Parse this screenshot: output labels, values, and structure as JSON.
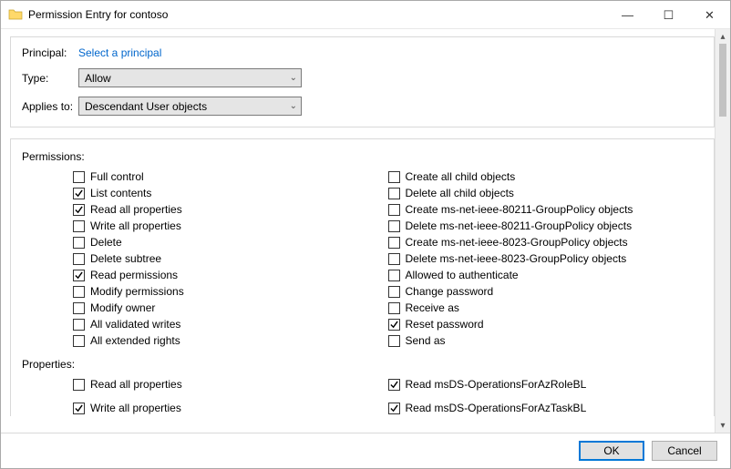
{
  "window": {
    "title": "Permission Entry for contoso",
    "minimize_glyph": "—",
    "maximize_glyph": "☐",
    "close_glyph": "✕"
  },
  "header": {
    "principal_label": "Principal:",
    "principal_link": "Select a principal",
    "type_label": "Type:",
    "type_value": "Allow",
    "applies_label": "Applies to:",
    "applies_value": "Descendant User objects"
  },
  "permissions": {
    "section_label": "Permissions:",
    "left": [
      {
        "label": "Full control",
        "checked": false
      },
      {
        "label": "List contents",
        "checked": true
      },
      {
        "label": "Read all properties",
        "checked": true
      },
      {
        "label": "Write all properties",
        "checked": false
      },
      {
        "label": "Delete",
        "checked": false
      },
      {
        "label": "Delete subtree",
        "checked": false
      },
      {
        "label": "Read permissions",
        "checked": true
      },
      {
        "label": "Modify permissions",
        "checked": false
      },
      {
        "label": "Modify owner",
        "checked": false
      },
      {
        "label": "All validated writes",
        "checked": false
      },
      {
        "label": "All extended rights",
        "checked": false
      }
    ],
    "right": [
      {
        "label": "Create all child objects",
        "checked": false
      },
      {
        "label": "Delete all child objects",
        "checked": false
      },
      {
        "label": "Create ms-net-ieee-80211-GroupPolicy objects",
        "checked": false
      },
      {
        "label": "Delete ms-net-ieee-80211-GroupPolicy objects",
        "checked": false
      },
      {
        "label": "Create ms-net-ieee-8023-GroupPolicy objects",
        "checked": false
      },
      {
        "label": "Delete ms-net-ieee-8023-GroupPolicy objects",
        "checked": false
      },
      {
        "label": "Allowed to authenticate",
        "checked": false
      },
      {
        "label": "Change password",
        "checked": false
      },
      {
        "label": "Receive as",
        "checked": false
      },
      {
        "label": "Reset password",
        "checked": true
      },
      {
        "label": "Send as",
        "checked": false
      }
    ]
  },
  "properties": {
    "section_label": "Properties:",
    "left": [
      {
        "label": "Read all properties",
        "checked": false
      },
      {
        "label": "Write all properties",
        "checked": true
      }
    ],
    "right": [
      {
        "label": "Read msDS-OperationsForAzRoleBL",
        "checked": true
      },
      {
        "label": "Read msDS-OperationsForAzTaskBL",
        "checked": true
      }
    ]
  },
  "footer": {
    "ok": "OK",
    "cancel": "Cancel"
  }
}
